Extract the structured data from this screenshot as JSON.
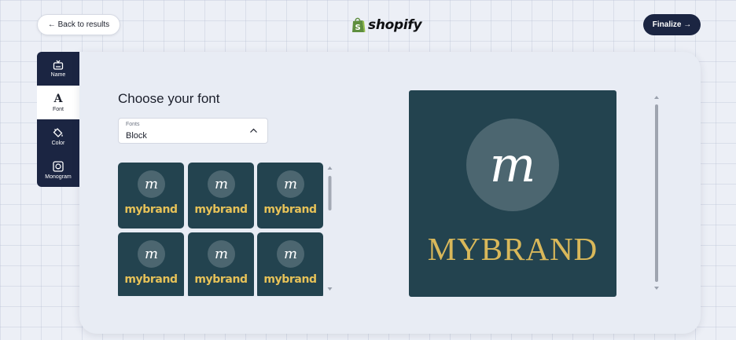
{
  "header": {
    "back_label": "← Back to results",
    "logo_text": "shopify",
    "finalize_label": "Finalize →"
  },
  "sidebar": {
    "items": [
      {
        "label": "Name",
        "icon": "name-icon"
      },
      {
        "label": "Font",
        "icon": "font-icon",
        "glyph": "A"
      },
      {
        "label": "Color",
        "icon": "paint-bucket-icon"
      },
      {
        "label": "Monogram",
        "icon": "monogram-icon"
      }
    ],
    "active": "Font"
  },
  "main": {
    "title": "Choose your font",
    "fonts_select": {
      "label": "Fonts",
      "value": "Block"
    },
    "tiles": [
      {
        "monogram": "m",
        "brand": "mybrand"
      },
      {
        "monogram": "m",
        "brand": "mybrand"
      },
      {
        "monogram": "m",
        "brand": "mybrand"
      },
      {
        "monogram": "m",
        "brand": "mybrand"
      },
      {
        "monogram": "m",
        "brand": "mybrand"
      },
      {
        "monogram": "m",
        "brand": "mybrand"
      }
    ],
    "preview": {
      "monogram": "m",
      "brand": "MYBRAND"
    }
  },
  "colors": {
    "navy": "#1b2542",
    "tile_bg": "#23434f",
    "circle_bg": "#4c6670",
    "brand_gold": "#e7c258"
  }
}
